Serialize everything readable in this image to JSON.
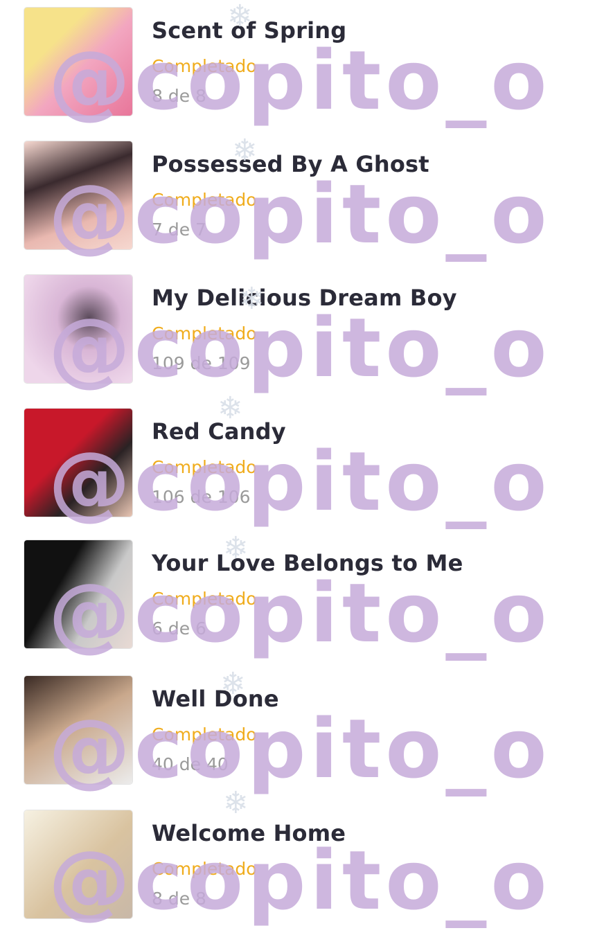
{
  "items": [
    {
      "title": "Scent of Spring",
      "status": "Completado",
      "count": "8 de 8",
      "cover_colors": [
        "#f6e28a",
        "#f2a6c0",
        "#e8769a"
      ]
    },
    {
      "title": "Possessed By A Ghost",
      "status": "Completado",
      "count": "7 de 7",
      "cover_colors": [
        "#f6d8d0",
        "#3a2a2e",
        "#e9b8b0"
      ]
    },
    {
      "title": "My Delicious Dream Boy",
      "status": "Completado",
      "count": "109 de 109",
      "cover_colors": [
        "#eed6ea",
        "#d9b6d6",
        "#5a4a5a"
      ]
    },
    {
      "title": "Red Candy",
      "status": "Completado",
      "count": "106 de 106",
      "cover_colors": [
        "#c8182a",
        "#2a2224",
        "#e9c6b4"
      ]
    },
    {
      "title": "Your Love Belongs to Me",
      "status": "Completado",
      "count": "6 de 6",
      "cover_colors": [
        "#111111",
        "#c9c9c9",
        "#e8dad4"
      ]
    },
    {
      "title": "Well Done",
      "status": "Completado",
      "count": "40 de 40",
      "cover_colors": [
        "#3a2a24",
        "#c9a88c",
        "#ececec"
      ]
    },
    {
      "title": "Welcome Home",
      "status": "Completado",
      "count": "8 de 8",
      "cover_colors": [
        "#f6f1e2",
        "#d9c3a0",
        "#c8b8a8"
      ]
    }
  ],
  "watermark": {
    "text": "@copito_o",
    "color": "#c5aad9"
  },
  "icons": {
    "snowflake": "snowflake-icon"
  },
  "colors": {
    "status": "#f0ac1c",
    "title": "#2b2b38",
    "count": "#9a9a9a"
  }
}
